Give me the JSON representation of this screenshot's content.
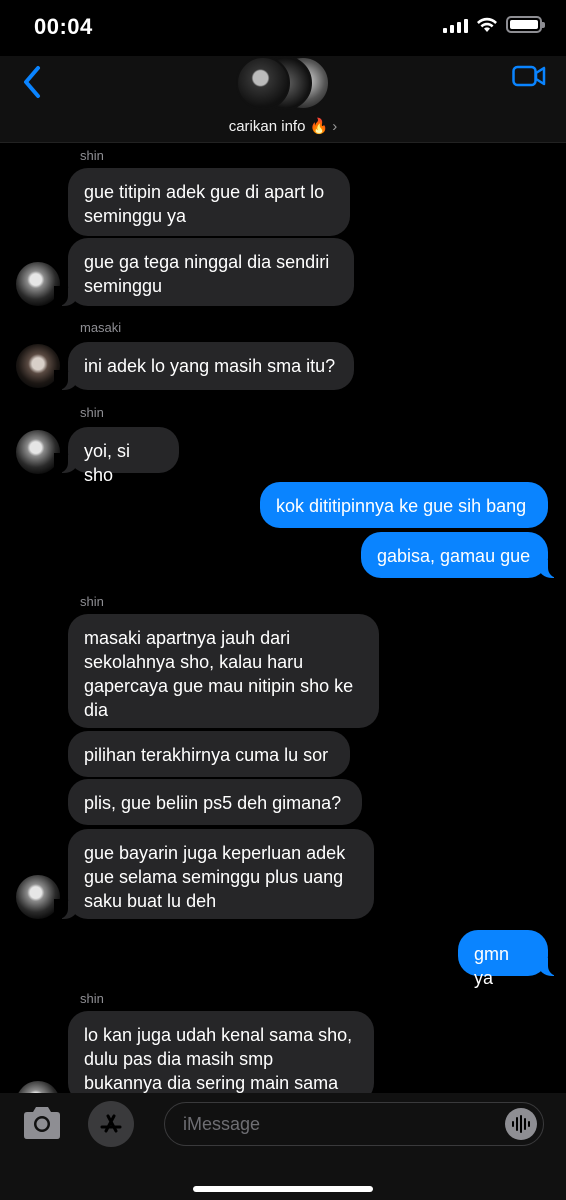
{
  "status_bar": {
    "time": "00:04"
  },
  "header": {
    "group_name": "carikan info 🔥",
    "chevron": "›",
    "icons": {
      "back": "chevron-left-icon",
      "video": "video-camera-icon"
    }
  },
  "messages": [
    {
      "sender": "shin",
      "side": "in",
      "text": "gue titipin adek gue di apart lo\nseminggu ya"
    },
    {
      "sender": "shin",
      "side": "in",
      "text": "gue ga tega ninggal dia sendiri\nseminggu"
    },
    {
      "sender": "masaki",
      "side": "in",
      "text": "ini adek lo yang masih sma itu?"
    },
    {
      "sender": "shin",
      "side": "in",
      "text": "yoi, si sho"
    },
    {
      "sender": "me",
      "side": "out",
      "text": "kok dititipinnya ke gue sih bang"
    },
    {
      "sender": "me",
      "side": "out",
      "text": "gabisa, gamau gue"
    },
    {
      "sender": "shin",
      "side": "in",
      "text": "masaki apartnya jauh dari\nsekolahnya sho, kalau haru\ngapercaya gue mau nitipin sho ke\ndia"
    },
    {
      "sender": "shin",
      "side": "in",
      "text": "pilihan terakhirnya cuma lu sor"
    },
    {
      "sender": "shin",
      "side": "in",
      "text": "plis, gue beliin ps5 deh gimana?"
    },
    {
      "sender": "shin",
      "side": "in",
      "text": "gue bayarin juga keperluan adek\ngue selama seminggu plus uang\nsaku buat lu deh"
    },
    {
      "sender": "me",
      "side": "out",
      "text": "gmn ya"
    },
    {
      "sender": "shin",
      "side": "in",
      "text": "lo kan juga udah kenal sama sho,\ndulu pas dia masih smp\nbukannya dia sering main sama"
    }
  ],
  "sender_labels": {
    "shin": "shin",
    "masaki": "masaki"
  },
  "input_bar": {
    "placeholder": "iMessage",
    "icons": {
      "camera": "camera-icon",
      "apps": "app-store-icon",
      "audio": "audio-waveform-icon"
    }
  },
  "colors": {
    "outgoing": "#0a84ff",
    "incoming": "#262628",
    "accent": "#0a84ff"
  }
}
